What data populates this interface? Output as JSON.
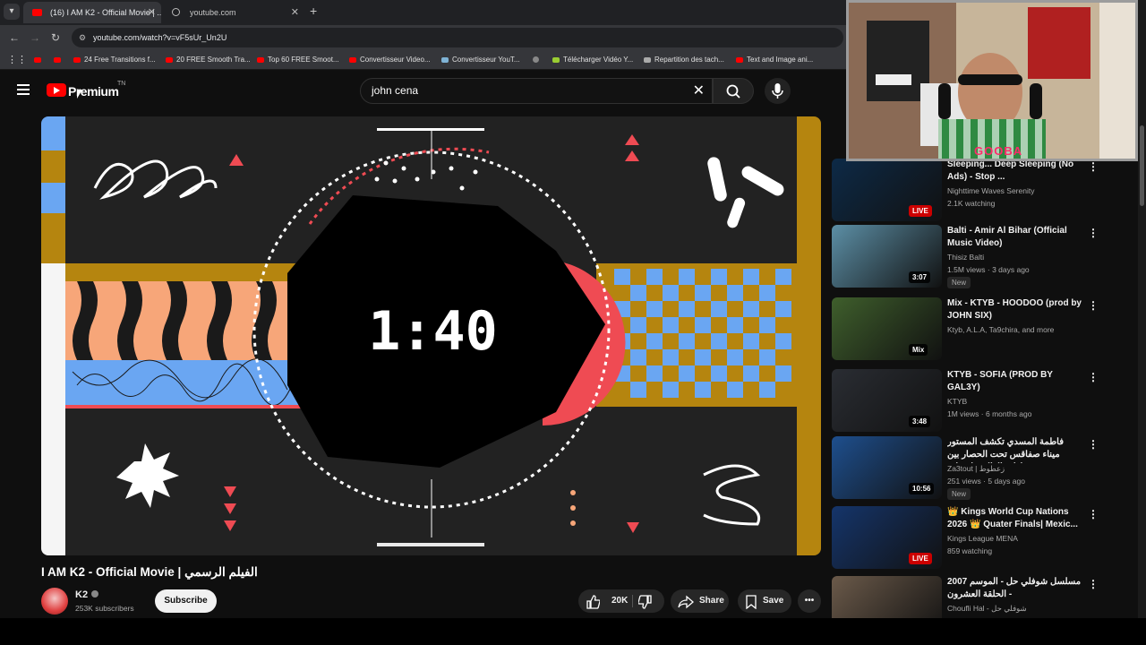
{
  "browser": {
    "tabs": [
      {
        "label": "(16) I AM K2 - Official Movie | ...",
        "active": true
      },
      {
        "label": "youtube.com",
        "active": false
      }
    ],
    "url": "youtube.com/watch?v=vF5sUr_Un2U",
    "bookmarks": [
      "24 Free Transitions f...",
      "20 FREE Smooth Tra...",
      "Top 60 FREE Smoot...",
      "Convertisseur Video...",
      "Convertisseur YouT...",
      "Télécharger Vidéo Y...",
      "Repartition des tach...",
      "Text and Image ani..."
    ]
  },
  "header": {
    "logo_text": "Premium",
    "logo_sup": "TN",
    "search_value": "john cena"
  },
  "player": {
    "timer_text": "1:40",
    "colors": {
      "orange": "#f7a679",
      "blue": "#6aa6f2",
      "mustard": "#b5850f",
      "red": "#ef4b53"
    }
  },
  "video": {
    "title": "I AM K2 - Official Movie | الفيلم الرسمي",
    "channel": "K2",
    "subscribers": "253K subscribers",
    "subscribe_label": "Subscribe",
    "likes": "20K",
    "share_label": "Share",
    "save_label": "Save"
  },
  "webcam": {
    "overlay_text": "GOOBA"
  },
  "sidebar": [
    {
      "title": "Sleeping... Deep Sleeping (No Ads) - Stop ...",
      "channel": "Nighttime Waves Serenity",
      "meta": "2.1K watching",
      "badge": "LIVE",
      "live": true,
      "new": "",
      "thumb": "#0d2a47"
    },
    {
      "title": "Balti - Amir Al Bihar (Official Music Video)",
      "channel": "Thisiz Balti",
      "meta": "1.5M views · 3 days ago",
      "badge": "3:07",
      "live": false,
      "new": "New",
      "thumb": "#5c8fa6"
    },
    {
      "title": "Mix - KTYB - HOODOO (prod by JOHN SIX)",
      "channel": "Ktyb, A.L.A, Ta9chira, and more",
      "meta": "",
      "badge": "Mix",
      "live": false,
      "new": "",
      "thumb": "#3f5f2c"
    },
    {
      "title": "KTYB - SOFIA (PROD BY GAL3Y)",
      "channel": "KTYB",
      "meta": "1M views · 6 months ago",
      "badge": "3:48",
      "live": false,
      "new": "",
      "thumb": "#2a2d33"
    },
    {
      "title": "فاطمة المسدي تكشف المستور ميناء صفاقس تحت الحصار بين قرارات الوالي واضراب ...",
      "channel": "Za3tout | زعطوط",
      "meta": "251 views · 5 days ago",
      "badge": "10:56",
      "live": false,
      "new": "New",
      "thumb": "#1e4f8e"
    },
    {
      "title": "👑 Kings World Cup Nations 2026 👑 Quater Finals| Mexic...",
      "channel": "Kings League MENA",
      "meta": "859 watching",
      "badge": "LIVE",
      "live": true,
      "new": "",
      "thumb": "#15356b"
    },
    {
      "title": "مسلسل شوفلي حل - الموسم 2007 - الحلقة العشرون",
      "channel": "Choufli Hal - شوفلي حل",
      "meta": "",
      "badge": "",
      "live": false,
      "new": "",
      "thumb": "#6b5a4a"
    }
  ]
}
